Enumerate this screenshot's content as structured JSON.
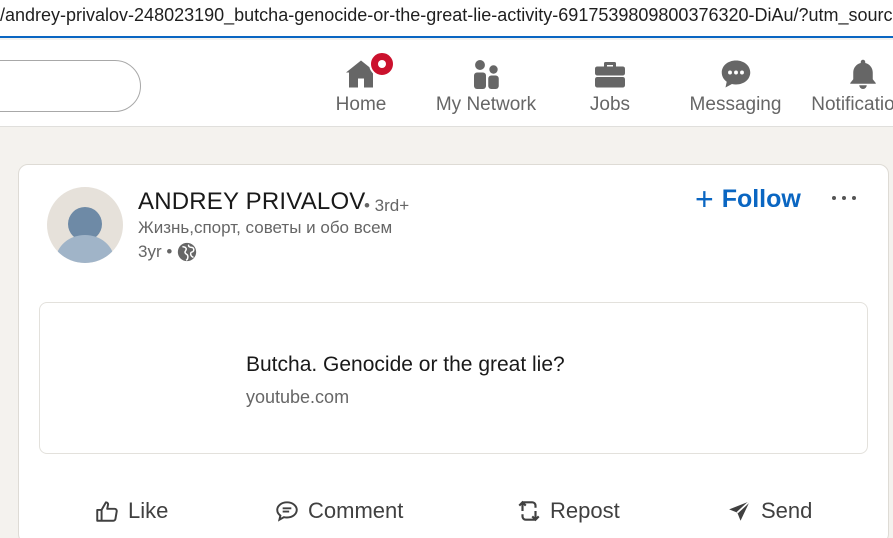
{
  "browser": {
    "url": "/andrey-privalov-248023190_butcha-genocide-or-the-great-lie-activity-6917539809800376320-DiAu/?utm_source="
  },
  "nav": {
    "items": [
      {
        "label": "Home",
        "icon": "home-icon",
        "badge": true
      },
      {
        "label": "My Network",
        "icon": "network-icon"
      },
      {
        "label": "Jobs",
        "icon": "briefcase-icon"
      },
      {
        "label": "Messaging",
        "icon": "messaging-icon"
      },
      {
        "label": "Notifications",
        "icon": "bell-icon"
      }
    ]
  },
  "post": {
    "author": {
      "name": "ANDREY PRIVALOV",
      "degree": "• 3rd+",
      "headline": "Жизнь,спорт, советы и обо всем",
      "time": "3yr •"
    },
    "follow_label": "Follow",
    "follow_plus": "+",
    "article": {
      "title": "Butcha. Genocide or the great lie?",
      "domain": "youtube.com"
    },
    "actions": {
      "like": "Like",
      "comment": "Comment",
      "repost": "Repost",
      "send": "Send"
    }
  },
  "colors": {
    "brand_blue": "#0a66c2",
    "notification_red": "#cb112d",
    "icon_gray": "#666666"
  }
}
